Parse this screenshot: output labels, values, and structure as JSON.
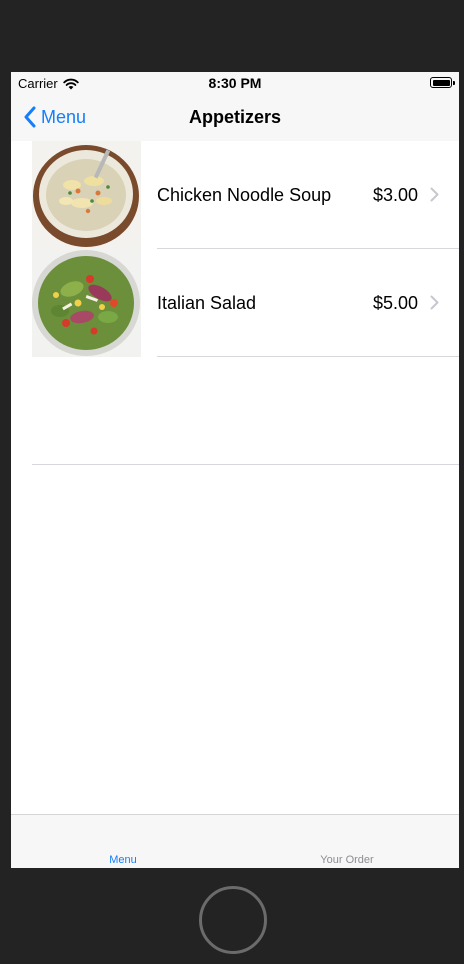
{
  "status_bar": {
    "carrier": "Carrier",
    "time": "8:30 PM"
  },
  "nav_bar": {
    "back_label": "Menu",
    "title": "Appetizers"
  },
  "items": [
    {
      "name": "Chicken Noodle Soup",
      "price": "$3.00",
      "image_icon": "soup-photo"
    },
    {
      "name": "Italian Salad",
      "price": "$5.00",
      "image_icon": "salad-photo"
    }
  ],
  "tab_bar": {
    "tabs": [
      {
        "label": "Menu",
        "selected": true
      },
      {
        "label": "Your Order",
        "selected": false
      }
    ]
  },
  "colors": {
    "accent": "#147efb",
    "inactive_tab": "#8e8e93",
    "device_frame": "#232323"
  }
}
